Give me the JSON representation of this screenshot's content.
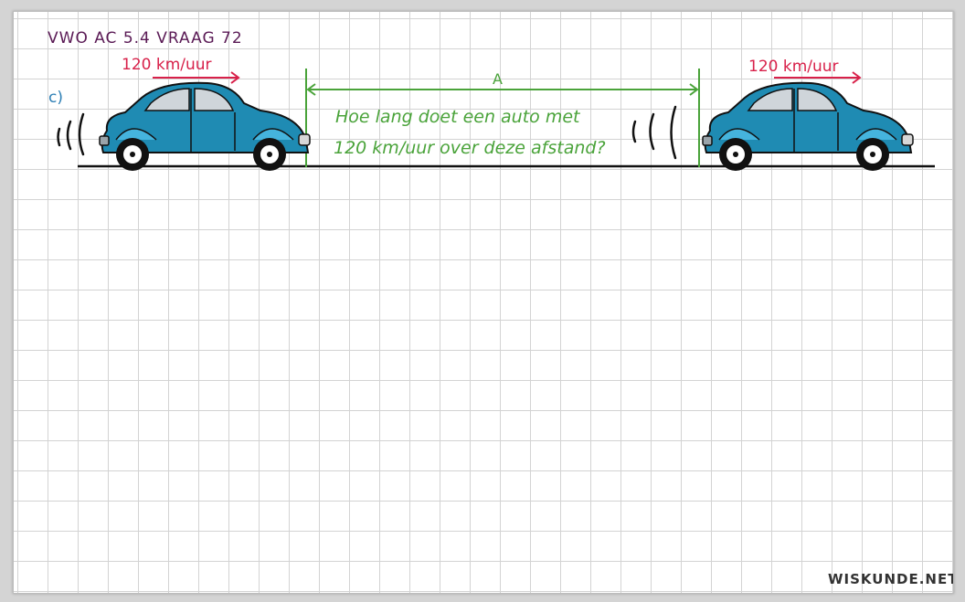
{
  "title": "VWO AC 5.4 VRAAG 72",
  "speed_left": "120 km/uur",
  "speed_right": "120 km/uur",
  "part_label": "c)",
  "distance_label": "A",
  "question_line1": "Hoe lang doet een auto met",
  "question_line2": "120 km/uur over deze afstand?",
  "brand": "WISKUNDE.NET",
  "colors": {
    "title": "#5a1a55",
    "speed": "#d8214a",
    "part_label": "#2d7fb5",
    "measure": "#4aa33a",
    "car_body": "#1f8bb3",
    "road": "#111111"
  },
  "icons": [
    "car-icon",
    "sound-waves-icon",
    "arrow-right-icon",
    "double-arrow-icon"
  ]
}
